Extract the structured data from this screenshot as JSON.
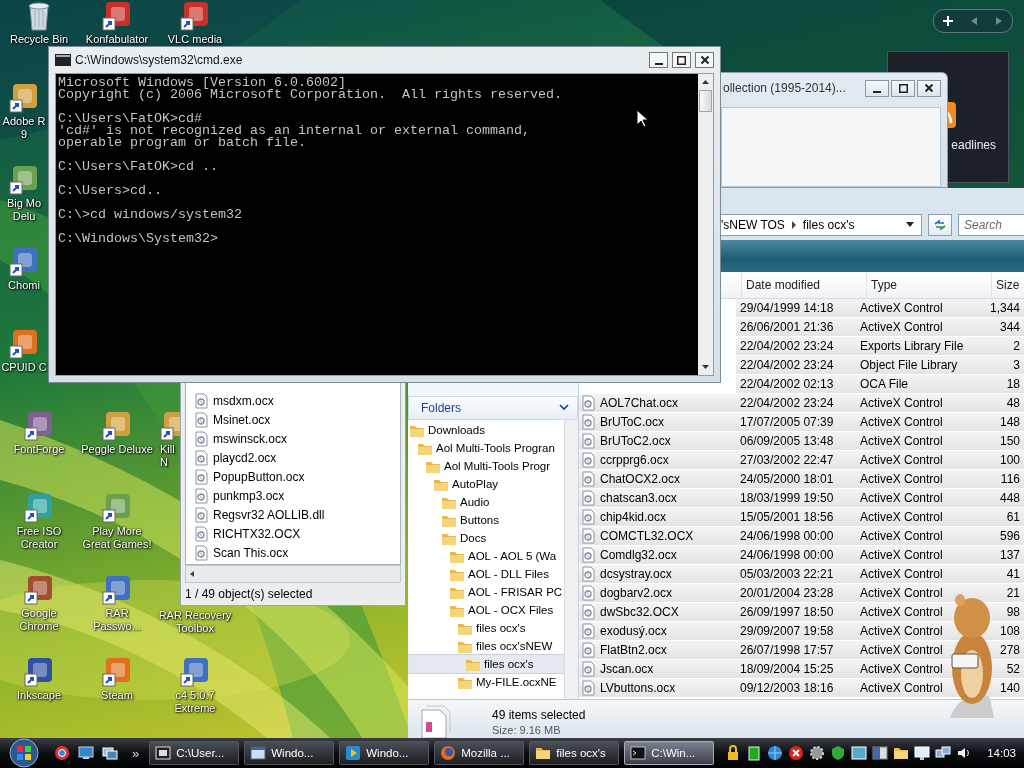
{
  "desktop": {
    "columns": [
      {
        "icons": [
          {
            "kind": "trash",
            "label": [
              "Recycle Bin"
            ]
          },
          {
            "kind": "shortcut",
            "label": [
              "Adobe R",
              "9"
            ]
          },
          {
            "kind": "shortcut",
            "label": [
              "Big Mo",
              "Delu"
            ]
          },
          {
            "kind": "shortcut",
            "label": [
              "Chomi"
            ]
          },
          {
            "kind": "shortcut",
            "label": [
              "CPUID C"
            ]
          },
          {
            "kind": "shortcut",
            "label": [
              "FontForge"
            ]
          },
          {
            "kind": "shortcut",
            "label": [
              "Free ISO",
              "Creator"
            ]
          },
          {
            "kind": "shortcut",
            "label": [
              "Google",
              "Chrome"
            ]
          },
          {
            "kind": "shortcut",
            "label": [
              "Inkscape"
            ]
          }
        ]
      },
      {
        "icons": [
          {
            "kind": "shortcut",
            "label": [
              "Konfabulator"
            ]
          },
          {
            "kind": "shortcut",
            "label": [
              "Peggle Deluxe"
            ]
          },
          {
            "kind": "shortcut",
            "label": [
              "Play More",
              "Great Games!"
            ]
          },
          {
            "kind": "shortcut",
            "label": [
              "RAR",
              "Passwo..."
            ]
          },
          {
            "kind": "shortcut",
            "label": [
              "Steam"
            ]
          }
        ]
      },
      {
        "icons": [
          {
            "kind": "shortcut",
            "label": [
              "VLC media"
            ]
          },
          {
            "kind": "shortcut",
            "label": [
              "Kill",
              "N"
            ]
          },
          {
            "kind": "label",
            "label": [
              "RAR Recovery",
              "Toolbox"
            ]
          },
          {
            "kind": "shortcut",
            "label": [
              "c4 5.0.7",
              "Extreme"
            ]
          }
        ]
      }
    ]
  },
  "gadget": {
    "title": "eadlines"
  },
  "background_window": {
    "title": "ollection (1995-2014)..."
  },
  "explorer": {
    "breadcrumb": [
      "'sNEW TOS",
      "files ocx's"
    ],
    "search": {
      "placeholder": "Search"
    },
    "nav": {
      "header": "Folders",
      "tree": [
        {
          "label": "Downloads",
          "selected": false,
          "children": [
            {
              "label": "Aol Multi-Tools Progran",
              "selected": false,
              "children": [
                {
                  "label": "Aol Multi-Tools Progr",
                  "selected": false,
                  "children": [
                    {
                      "label": "AutoPlay",
                      "selected": false,
                      "children": [
                        {
                          "label": "Audio",
                          "selected": false
                        },
                        {
                          "label": "Buttons",
                          "selected": false
                        },
                        {
                          "label": "Docs",
                          "selected": false,
                          "children": [
                            {
                              "label": "AOL - AOL 5 (Wa",
                              "selected": false
                            },
                            {
                              "label": "AOL - DLL Files",
                              "selected": false
                            },
                            {
                              "label": "AOL - FRISAR PC",
                              "selected": false
                            },
                            {
                              "label": "AOL - OCX Files",
                              "selected": false,
                              "children": [
                                {
                                  "label": "files ocx's",
                                  "selected": false
                                },
                                {
                                  "label": "files ocx'sNEW",
                                  "selected": false,
                                  "children": [
                                    {
                                      "label": "files ocx's",
                                      "selected": true
                                    }
                                  ]
                                },
                                {
                                  "label": "My-FILE.ocxNE",
                                  "selected": false
                                }
                              ]
                            }
                          ]
                        }
                      ]
                    }
                  ]
                }
              ]
            }
          ]
        }
      ]
    },
    "columns": [
      "Date modified",
      "Type",
      "Size"
    ],
    "rows": [
      {
        "date": "29/04/1999 14:18",
        "type": "ActiveX Control",
        "size": "1,344",
        "selected": true
      },
      {
        "date": "26/06/2001 21:36",
        "type": "ActiveX Control",
        "size": "344",
        "selected": true
      },
      {
        "date": "22/04/2002 23:24",
        "type": "Exports Library File",
        "size": "2",
        "selected": true
      },
      {
        "date": "22/04/2002 23:24",
        "type": "Object File Library",
        "size": "3",
        "selected": true
      },
      {
        "date": "22/04/2002 02:13",
        "type": "OCA File",
        "size": "18",
        "selected": true
      },
      {
        "name": "AOL7Chat.ocx",
        "date": "22/04/2002 23:24",
        "type": "ActiveX Control",
        "size": "48",
        "selected": true
      },
      {
        "name": "BrUToC.ocx",
        "date": "17/07/2005 07:39",
        "type": "ActiveX Control",
        "size": "148",
        "selected": true
      },
      {
        "name": "BrUToC2.ocx",
        "date": "06/09/2005 13:48",
        "type": "ActiveX Control",
        "size": "150",
        "selected": true
      },
      {
        "name": "ccrpprg6.ocx",
        "date": "27/03/2002 22:47",
        "type": "ActiveX Control",
        "size": "100",
        "selected": true
      },
      {
        "name": "ChatOCX2.ocx",
        "date": "24/05/2000 18:01",
        "type": "ActiveX Control",
        "size": "116",
        "selected": true
      },
      {
        "name": "chatscan3.ocx",
        "date": "18/03/1999 19:50",
        "type": "ActiveX Control",
        "size": "448",
        "selected": true
      },
      {
        "name": "chip4kid.ocx",
        "date": "15/05/2001 18:56",
        "type": "ActiveX Control",
        "size": "61",
        "selected": true
      },
      {
        "name": "COMCTL32.OCX",
        "date": "24/06/1998 00:00",
        "type": "ActiveX Control",
        "size": "596",
        "selected": true
      },
      {
        "name": "Comdlg32.ocx",
        "date": "24/06/1998 00:00",
        "type": "ActiveX Control",
        "size": "137",
        "selected": true
      },
      {
        "name": "dcsystray.ocx",
        "date": "05/03/2003 22:21",
        "type": "ActiveX Control",
        "size": "41",
        "selected": true
      },
      {
        "name": "dogbarv2.ocx",
        "date": "20/01/2004 23:28",
        "type": "ActiveX Control",
        "size": "21",
        "selected": true
      },
      {
        "name": "dwSbc32.OCX",
        "date": "26/09/1997 18:50",
        "type": "ActiveX Control",
        "size": "98",
        "selected": true
      },
      {
        "name": "exodusý.ocx",
        "date": "29/09/2007 19:58",
        "type": "ActiveX Control",
        "size": "108",
        "selected": true
      },
      {
        "name": "FlatBtn2.ocx",
        "date": "26/07/1998 17:57",
        "type": "ActiveX Control",
        "size": "278",
        "selected": true
      },
      {
        "name": "Jscan.ocx",
        "date": "18/09/2004 15:25",
        "type": "ActiveX Control",
        "size": "52",
        "selected": true
      },
      {
        "name": "LVbuttons.ocx",
        "date": "09/12/2003 18:16",
        "type": "ActiveX Control",
        "size": "140",
        "selected": true
      }
    ],
    "details": {
      "count": "49 items selected",
      "size": "Size: 9.16 MB"
    }
  },
  "file_window": {
    "items": [
      "msdxm.ocx",
      "Msinet.ocx",
      "mswinsck.ocx",
      "playcd2.ocx",
      "PopupButton.ocx",
      "punkmp3.ocx",
      "Regsvr32  AOLLIB.dll",
      "RICHTX32.OCX",
      "Scan This.ocx"
    ],
    "status": "1 / 49 object(s) selected"
  },
  "cmd": {
    "title": "C:\\Windows\\system32\\cmd.exe",
    "blocks": [
      [
        "Microsoft Windows [Version 6.0.6002]",
        "Copyright (c) 2006 Microsoft Corporation.  All rights reserved."
      ],
      [
        "C:\\Users\\FatOK>cd#",
        "'cd#' is not recognized as an internal or external command,",
        "operable program or batch file."
      ],
      [
        "C:\\Users\\FatOK>cd .."
      ],
      [
        "C:\\Users>cd.."
      ],
      [
        "C:\\>cd windows/system32"
      ],
      [
        "C:\\Windows\\System32>"
      ]
    ]
  },
  "taskbar": {
    "more": "»",
    "tasks": [
      {
        "kind": "archive",
        "label": "C:\\User...",
        "selected": false
      },
      {
        "kind": "window",
        "label": "Windo...",
        "selected": false
      },
      {
        "kind": "player",
        "label": "Windo...",
        "selected": false
      },
      {
        "kind": "browser",
        "label": "Mozilla ...",
        "selected": false
      },
      {
        "kind": "folder",
        "label": "files ocx's",
        "selected": false
      },
      {
        "kind": "console",
        "label": "C:\\Win...",
        "selected": true
      }
    ],
    "clock": "14:03"
  }
}
